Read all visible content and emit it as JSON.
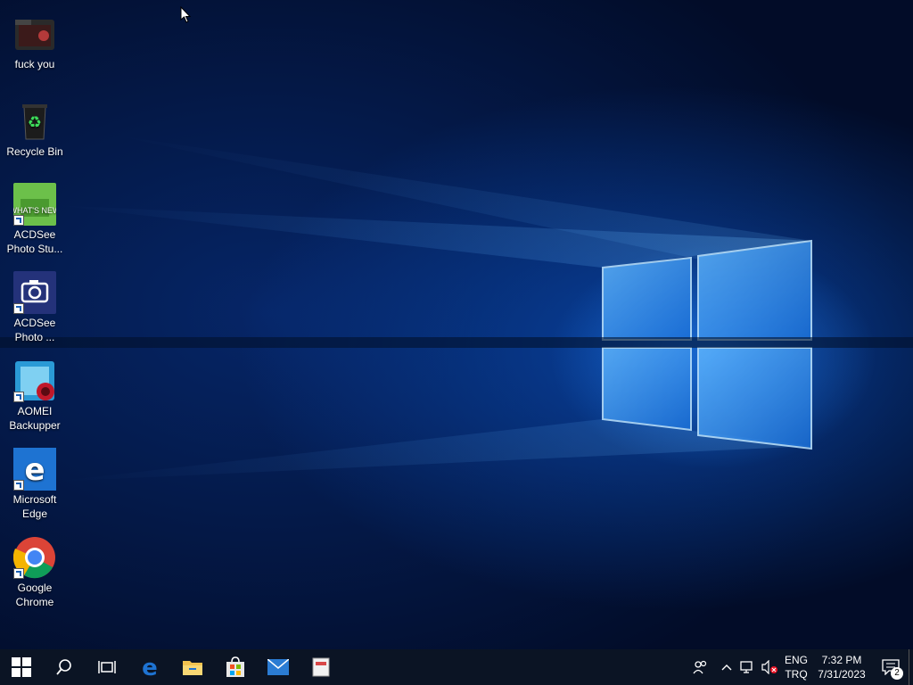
{
  "desktop": {
    "icons": [
      {
        "label": "fuck you",
        "icon": "folder-icon"
      },
      {
        "label": "Recycle Bin",
        "icon": "recycle-bin-icon"
      },
      {
        "label": "ACDSee Photo Stu...",
        "icon": "acdsee-whats-new-icon",
        "badge": "WHAT'S NEW"
      },
      {
        "label": "ACDSee Photo ...",
        "icon": "acdsee-camera-icon"
      },
      {
        "label": "AOMEI Backupper",
        "icon": "aomei-backupper-icon"
      },
      {
        "label": "Microsoft Edge",
        "icon": "edge-icon"
      },
      {
        "label": "Google Chrome",
        "icon": "chrome-icon"
      }
    ]
  },
  "taskbar": {
    "buttons": [
      {
        "name": "start",
        "icon": "windows-logo-icon"
      },
      {
        "name": "search",
        "icon": "search-icon"
      },
      {
        "name": "task-view",
        "icon": "task-view-icon"
      },
      {
        "name": "edge",
        "icon": "edge-icon"
      },
      {
        "name": "file-explorer",
        "icon": "folder-icon"
      },
      {
        "name": "store",
        "icon": "store-icon"
      },
      {
        "name": "mail",
        "icon": "mail-icon"
      },
      {
        "name": "app",
        "icon": "document-icon"
      }
    ],
    "tray": {
      "language_line1": "ENG",
      "language_line2": "TRQ",
      "time": "7:32 PM",
      "date": "7/31/2023",
      "notification_count": "2"
    }
  },
  "colors": {
    "taskbar_bg": "#0b1424",
    "edge_blue": "#1e73d2",
    "folder_yellow": "#f3c24f",
    "mail_blue": "#2b7cd3"
  }
}
